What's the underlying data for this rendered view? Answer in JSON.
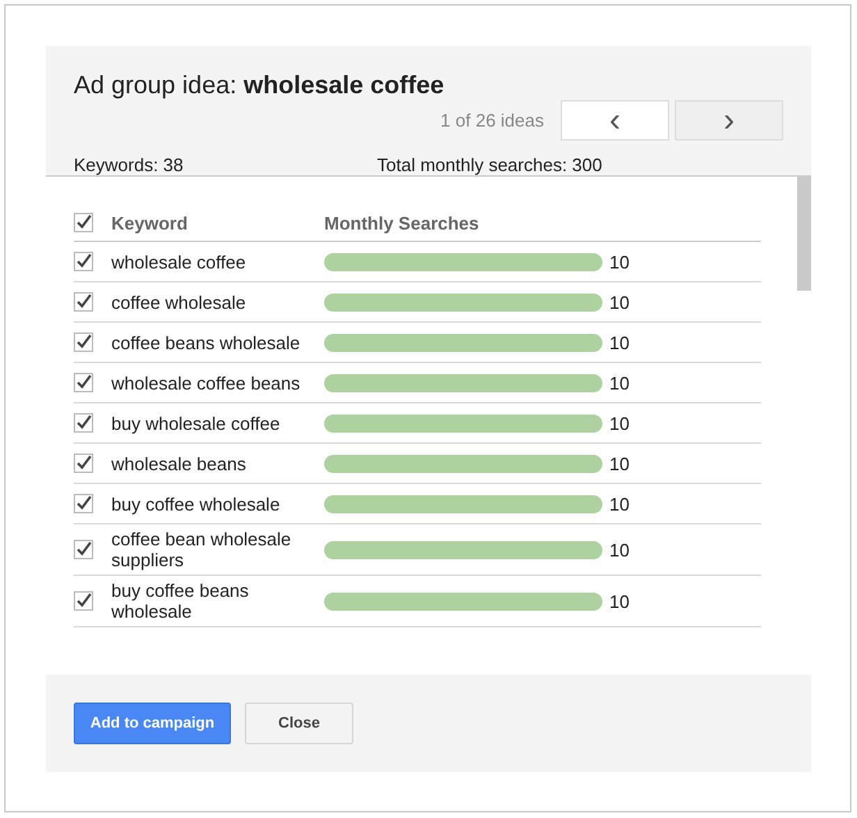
{
  "dialog": {
    "title_prefix": "Ad group idea: ",
    "title_name": "wholesale coffee",
    "pager": "1 of 26 ideas",
    "nav_buttons": [
      {
        "label": "‹",
        "disabled": false
      },
      {
        "label": "›",
        "disabled": true
      }
    ],
    "keywords_count": "Keywords: 38",
    "total_searches": "Total monthly searches: 300"
  },
  "table": {
    "all_checked": true,
    "columns": [
      "Keyword",
      "Monthly Searches"
    ],
    "rows": [
      {
        "keyword": "wholesale coffee",
        "checked": true,
        "searches": "10"
      },
      {
        "keyword": "coffee wholesale",
        "checked": true,
        "searches": "10"
      },
      {
        "keyword": "coffee beans wholesale",
        "checked": true,
        "searches": "10"
      },
      {
        "keyword": "wholesale coffee beans",
        "checked": true,
        "searches": "10"
      },
      {
        "keyword": "buy wholesale coffee",
        "checked": true,
        "searches": "10"
      },
      {
        "keyword": "wholesale beans",
        "checked": true,
        "searches": "10"
      },
      {
        "keyword": "buy coffee wholesale",
        "checked": true,
        "searches": "10"
      },
      {
        "keyword": "coffee bean wholesale suppliers",
        "checked": true,
        "searches": "10"
      },
      {
        "keyword": "buy coffee beans wholesale",
        "checked": true,
        "searches": "10"
      }
    ]
  },
  "buttons": [
    {
      "label": "Add to campaign",
      "kind": "primary"
    },
    {
      "label": "Close",
      "kind": "secondary"
    }
  ]
}
